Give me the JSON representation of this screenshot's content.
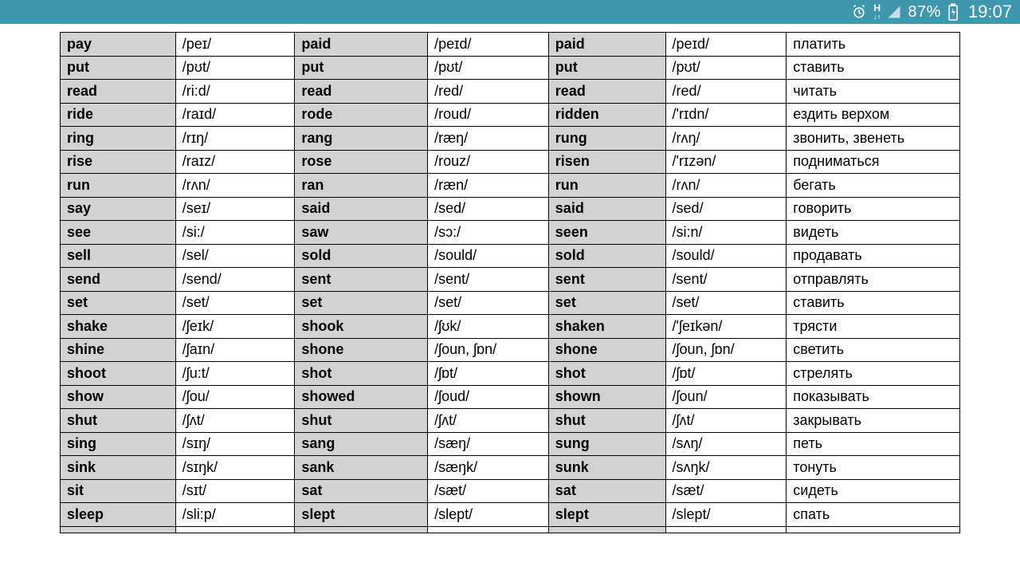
{
  "status": {
    "battery": "87%",
    "time": "19:07"
  },
  "rows": [
    {
      "v1": "pay",
      "p1": "/peɪ/",
      "v2": "paid",
      "p2": "/peɪd/",
      "v3": "paid",
      "p3": "/peɪd/",
      "ru": "платить"
    },
    {
      "v1": "put",
      "p1": "/pʊt/",
      "v2": "put",
      "p2": "/pʊt/",
      "v3": "put",
      "p3": "/pʊt/",
      "ru": "ставить"
    },
    {
      "v1": "read",
      "p1": "/ri:d/",
      "v2": "read",
      "p2": "/red/",
      "v3": "read",
      "p3": "/red/",
      "ru": "читать"
    },
    {
      "v1": "ride",
      "p1": "/raɪd/",
      "v2": "rode",
      "p2": "/roud/",
      "v3": "ridden",
      "p3": "/'rɪdn/",
      "ru": "ездить верхом"
    },
    {
      "v1": "ring",
      "p1": "/rɪŋ/",
      "v2": "rang",
      "p2": "/ræŋ/",
      "v3": "rung",
      "p3": "/rʌŋ/",
      "ru": "звонить, звенеть"
    },
    {
      "v1": "rise",
      "p1": "/raɪz/",
      "v2": "rose",
      "p2": "/rouz/",
      "v3": "risen",
      "p3": "/'rɪzən/",
      "ru": "подниматься"
    },
    {
      "v1": "run",
      "p1": "/rʌn/",
      "v2": "ran",
      "p2": "/ræn/",
      "v3": "run",
      "p3": "/rʌn/",
      "ru": "бегать"
    },
    {
      "v1": "say",
      "p1": "/seɪ/",
      "v2": "said",
      "p2": "/sed/",
      "v3": "said",
      "p3": "/sed/",
      "ru": "говорить"
    },
    {
      "v1": "see",
      "p1": "/si:/",
      "v2": "saw",
      "p2": "/sɔ:/",
      "v3": "seen",
      "p3": "/si:n/",
      "ru": "видеть"
    },
    {
      "v1": "sell",
      "p1": "/sel/",
      "v2": "sold",
      "p2": "/sould/",
      "v3": "sold",
      "p3": "/sould/",
      "ru": "продавать"
    },
    {
      "v1": "send",
      "p1": "/send/",
      "v2": "sent",
      "p2": "/sent/",
      "v3": "sent",
      "p3": "/sent/",
      "ru": "отправлять"
    },
    {
      "v1": "set",
      "p1": "/set/",
      "v2": "set",
      "p2": "/set/",
      "v3": "set",
      "p3": "/set/",
      "ru": "ставить"
    },
    {
      "v1": "shake",
      "p1": "/ʃeɪk/",
      "v2": "shook",
      "p2": "/ʃʊk/",
      "v3": "shaken",
      "p3": "/'ʃeɪkən/",
      "ru": "трясти"
    },
    {
      "v1": "shine",
      "p1": "/ʃaɪn/",
      "v2": "shone",
      "p2": "/ʃoun, ʃɒn/",
      "v3": "shone",
      "p3": "/ʃoun, ʃɒn/",
      "ru": "светить"
    },
    {
      "v1": "shoot",
      "p1": "/ʃu:t/",
      "v2": "shot",
      "p2": "/ʃɒt/",
      "v3": "shot",
      "p3": "/ʃɒt/",
      "ru": "стрелять"
    },
    {
      "v1": "show",
      "p1": "/ʃou/",
      "v2": "showed",
      "p2": "/ʃoud/",
      "v3": "shown",
      "p3": "/ʃoun/",
      "ru": "показывать"
    },
    {
      "v1": "shut",
      "p1": "/ʃʌt/",
      "v2": "shut",
      "p2": "/ʃʌt/",
      "v3": "shut",
      "p3": "/ʃʌt/",
      "ru": "закрывать"
    },
    {
      "v1": "sing",
      "p1": "/sɪŋ/",
      "v2": "sang",
      "p2": "/sæŋ/",
      "v3": "sung",
      "p3": "/sʌŋ/",
      "ru": "петь"
    },
    {
      "v1": "sink",
      "p1": "/sɪŋk/",
      "v2": "sank",
      "p2": "/sæŋk/",
      "v3": "sunk",
      "p3": "/sʌŋk/",
      "ru": "тонуть"
    },
    {
      "v1": "sit",
      "p1": "/sɪt/",
      "v2": "sat",
      "p2": "/sæt/",
      "v3": "sat",
      "p3": "/sæt/",
      "ru": "сидеть"
    },
    {
      "v1": "sleep",
      "p1": "/sli:p/",
      "v2": "slept",
      "p2": "/slept/",
      "v3": "slept",
      "p3": "/slept/",
      "ru": "спать"
    }
  ]
}
